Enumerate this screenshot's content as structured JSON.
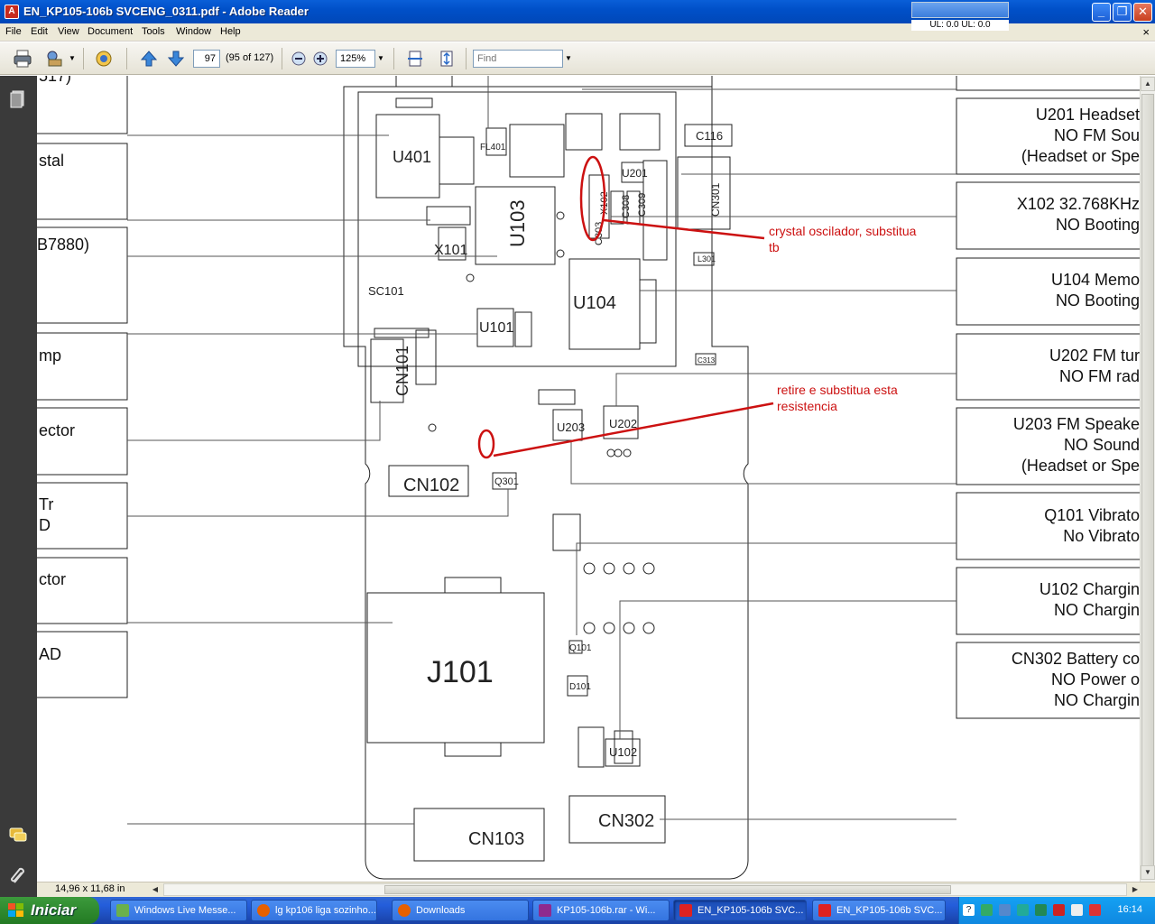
{
  "window": {
    "title": "EN_KP105-106b SVCENG_0311.pdf - Adobe Reader",
    "net_meter": "UL: 0.0 UL: 0.0"
  },
  "menu": [
    "File",
    "Edit",
    "View",
    "Document",
    "Tools",
    "Window",
    "Help"
  ],
  "toolbar": {
    "page_value": "97",
    "page_count": "(95 of 127)",
    "zoom_value": "125%",
    "find_placeholder": "Find"
  },
  "status": {
    "page_size": "14,96 x 11,68 in"
  },
  "document": {
    "left_labels": [
      "517)",
      "stal",
      "B7880)",
      "mp",
      "ector",
      "Tr",
      "D",
      "ctor",
      "AD"
    ],
    "right_boxes": [
      {
        "lines": [
          "U201 Headset",
          "NO FM Sou",
          "(Headset or Spe"
        ]
      },
      {
        "lines": [
          "X102 32.768KHz",
          "NO Booting"
        ]
      },
      {
        "lines": [
          "U104 Memo",
          "NO Booting"
        ]
      },
      {
        "lines": [
          "U202 FM tur",
          "NO FM rad"
        ]
      },
      {
        "lines": [
          "U203 FM Speake",
          "NO Sound",
          "(Headset or Spe"
        ]
      },
      {
        "lines": [
          "Q101 Vibrato",
          "No Vibrato"
        ]
      },
      {
        "lines": [
          "U102 Chargin",
          "NO Chargin"
        ]
      },
      {
        "lines": [
          "CN302 Battery co",
          "NO Power o",
          "NO Chargin"
        ]
      }
    ],
    "components": [
      "U401",
      "FL401",
      "U103",
      "X101",
      "SC101",
      "U101",
      "CN101",
      "U104",
      "X102",
      "C308",
      "C309",
      "C303",
      "U201",
      "C116",
      "CN301",
      "U203",
      "U202",
      "CN102",
      "Q301",
      "J101",
      "Q101",
      "D101",
      "U102",
      "CN302",
      "CN103",
      "L301",
      "C313"
    ],
    "annotations": [
      {
        "lines": [
          "crystal oscilador, substitua",
          "tb"
        ]
      },
      {
        "lines": [
          "retire e substitua esta",
          "resistencia"
        ]
      }
    ],
    "colors": {
      "annotation": "#cc1111",
      "schematic": "#222222"
    }
  },
  "taskbar": {
    "start_label": "Iniciar",
    "tasks": [
      {
        "label": "Windows Live Messe...",
        "icon": "messenger-icon"
      },
      {
        "label": "lg kp106 liga sozinho...",
        "icon": "firefox-icon"
      },
      {
        "label": "Downloads",
        "icon": "firefox-icon"
      },
      {
        "label": "KP105-106b.rar - Wi...",
        "icon": "winrar-icon"
      },
      {
        "label": "EN_KP105-106b SVC...",
        "icon": "pdf-icon",
        "active": true
      },
      {
        "label": "EN_KP105-106b SVC...",
        "icon": "pdf-icon"
      }
    ],
    "clock": "16:14"
  }
}
